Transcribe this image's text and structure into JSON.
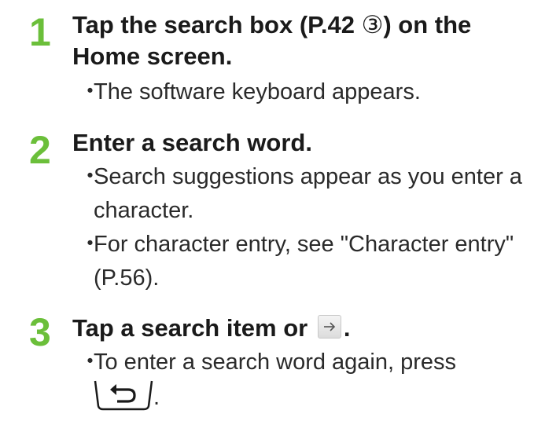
{
  "steps": [
    {
      "number": "1",
      "title_part1": "Tap the search box (P.42 ",
      "title_circled": "③",
      "title_part2": ") on the Home screen.",
      "bullets": [
        "The software keyboard appears."
      ]
    },
    {
      "number": "2",
      "title": "Enter a search word.",
      "bullets": [
        "Search suggestions appear as you enter a character.",
        "For character entry, see \"Character entry\" (P.56)."
      ]
    },
    {
      "number": "3",
      "title_before_icon": "Tap a search item or",
      "title_after_icon": ".",
      "bullets": [
        "To enter a search word again, press"
      ],
      "bullet_after_icon": "."
    }
  ],
  "bullet_symbol": "・",
  "colors": {
    "step_number": "#6bbf3a",
    "text": "#1a1a1a"
  },
  "icons": {
    "arrow_button": "right-arrow-icon",
    "back_key": "back-key-icon"
  }
}
